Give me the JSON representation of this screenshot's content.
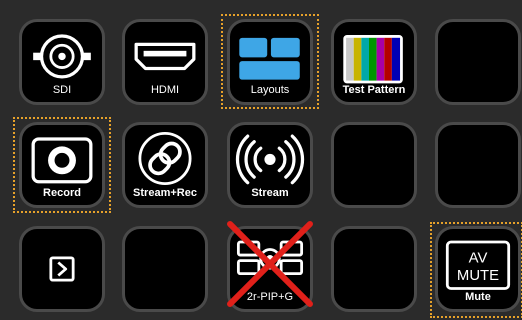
{
  "keys": [
    {
      "label": "SDI",
      "icon": "sdi-connector-icon",
      "bold": false
    },
    {
      "label": "HDMI",
      "icon": "hdmi-connector-icon",
      "bold": false
    },
    {
      "label": "Layouts",
      "icon": "layouts-icon",
      "bold": false,
      "selected": true
    },
    {
      "label": "Test Pattern",
      "icon": "test-pattern-icon",
      "bold": true
    },
    {
      "label": "",
      "icon": ""
    },
    {
      "label": "Record",
      "icon": "record-icon",
      "bold": true,
      "selected": true
    },
    {
      "label": "Stream+Rec",
      "icon": "stream-rec-icon",
      "bold": true
    },
    {
      "label": "Stream",
      "icon": "stream-icon",
      "bold": true
    },
    {
      "label": "",
      "icon": ""
    },
    {
      "label": "",
      "icon": ""
    },
    {
      "label": "",
      "icon": "next-page-icon"
    },
    {
      "label": "",
      "icon": ""
    },
    {
      "label": "2r-PIP+G",
      "icon": "pip-disabled-icon",
      "bold": false,
      "disabled": true
    },
    {
      "label": "",
      "icon": ""
    },
    {
      "label": "Mute",
      "icon": "av-mute-icon",
      "bold": true,
      "selected": true,
      "icon_text_1": "AV",
      "icon_text_2": "MUTE"
    }
  ],
  "colors": {
    "selection": "#e6a12a",
    "disabled_x": "#e0201a",
    "test_pattern": [
      "#c8c8c8",
      "#c8b400",
      "#00a8a8",
      "#009600",
      "#a800a8",
      "#b40000",
      "#0000b4"
    ]
  }
}
